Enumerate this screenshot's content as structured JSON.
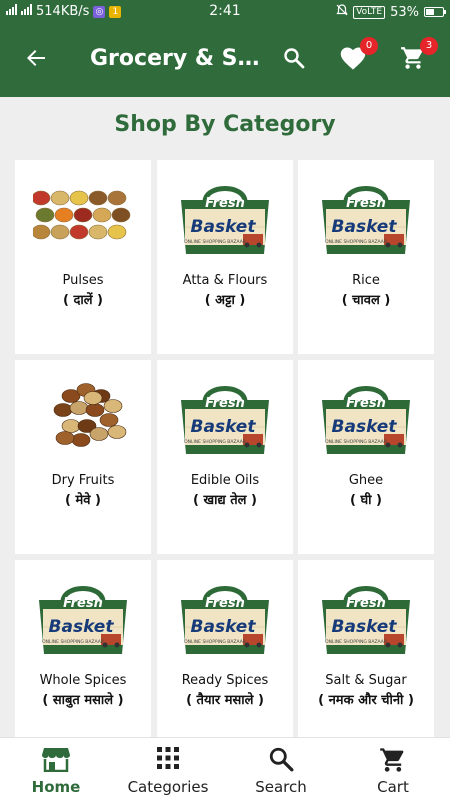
{
  "status_bar": {
    "network_speed": "514KB/s",
    "time": "2:41",
    "volte": "VoLTE",
    "battery": "53%",
    "battery_level": 0.53
  },
  "app_bar": {
    "title": "Grocery & Staples",
    "wishlist_count": "0",
    "cart_count": "3"
  },
  "main": {
    "section_title": "Shop By Category",
    "logo_text": {
      "fresh": "Fresh",
      "basket": "Basket",
      "tagline": "ONLINE SHOPPING BAZAAR"
    },
    "categories": [
      {
        "name": "Pulses",
        "hindi": "( दालें )",
        "image": "pulses-photo"
      },
      {
        "name": "Atta & Flours",
        "hindi": "( अट्टा )",
        "image": "fresh-basket-logo"
      },
      {
        "name": "Rice",
        "hindi": "( चावल )",
        "image": "fresh-basket-logo"
      },
      {
        "name": "Dry Fruits",
        "hindi": "( मेवे )",
        "image": "dry-fruits-photo"
      },
      {
        "name": "Edible Oils",
        "hindi": "( खाद्य तेल )",
        "image": "fresh-basket-logo"
      },
      {
        "name": "Ghee",
        "hindi": "( घी )",
        "image": "fresh-basket-logo"
      },
      {
        "name": "Whole Spices",
        "hindi": "( साबुत मसाले )",
        "image": "fresh-basket-logo"
      },
      {
        "name": "Ready Spices",
        "hindi": "( तैयार मसाले )",
        "image": "fresh-basket-logo"
      },
      {
        "name": "Salt & Sugar",
        "hindi": "( नमक और चीनी )",
        "image": "fresh-basket-logo"
      }
    ]
  },
  "bottom_nav": {
    "items": [
      {
        "label": "Home",
        "icon": "store-icon",
        "active": true
      },
      {
        "label": "Categories",
        "icon": "grid-icon",
        "active": false
      },
      {
        "label": "Search",
        "icon": "search-icon",
        "active": false
      },
      {
        "label": "Cart",
        "icon": "cart-icon",
        "active": false
      }
    ]
  },
  "colors": {
    "brand_green": "#2f6b3b",
    "badge_red": "#e5252a",
    "background": "#eeeeee"
  }
}
